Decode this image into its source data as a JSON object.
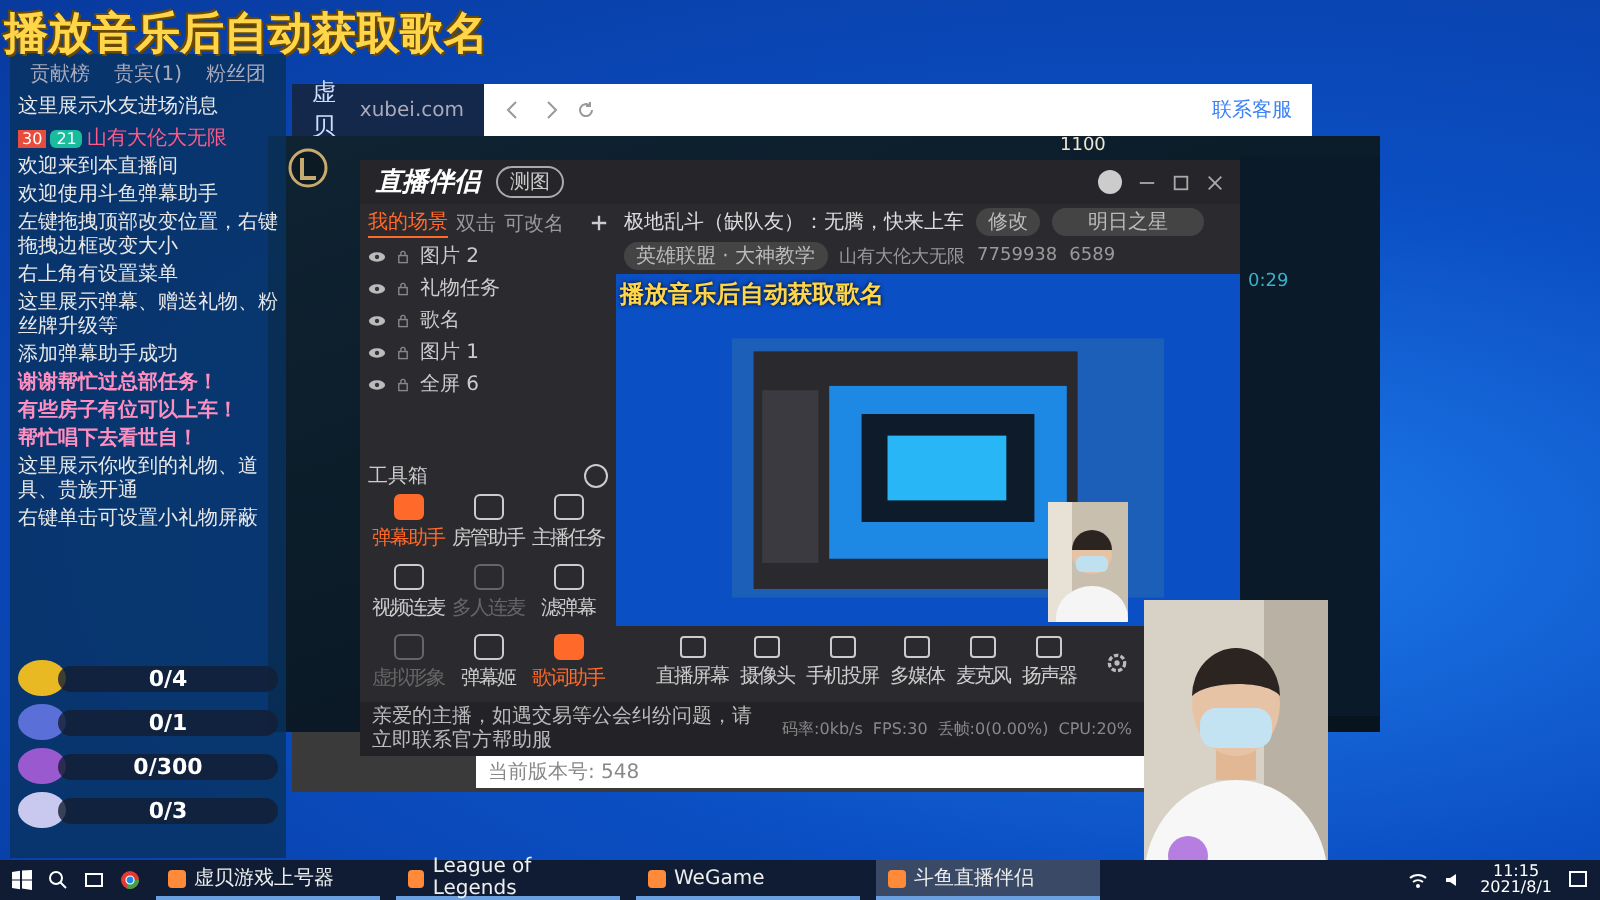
{
  "headline": "播放音乐后自动获取歌名",
  "overlay_panel": {
    "tabs": [
      {
        "label": "贡献榜",
        "selected": false
      },
      {
        "label": "贵宾(1)",
        "selected": false
      },
      {
        "label": "粉丝团",
        "selected": false
      }
    ],
    "messages": [
      {
        "kind": "plain",
        "text": "这里展示水友进场消息"
      },
      {
        "kind": "entry",
        "badge": "30",
        "level": "21",
        "user": "山有大伦大无限",
        "text": "欢迎来到本直播间"
      },
      {
        "kind": "plain",
        "text": "欢迎使用斗鱼弹幕助手"
      },
      {
        "kind": "plain",
        "text": "左键拖拽顶部改变位置，右键拖拽边框改变大小"
      },
      {
        "kind": "plain",
        "text": "右上角有设置菜单"
      },
      {
        "kind": "plain",
        "text": "这里展示弹幕、赠送礼物、粉丝牌升级等"
      },
      {
        "kind": "plain",
        "text": "添加弹幕助手成功"
      },
      {
        "kind": "pink",
        "text": "谢谢帮忙过总部任务！"
      },
      {
        "kind": "pink",
        "text": "有些房子有位可以上车！"
      },
      {
        "kind": "pink",
        "text": "帮忙唱下去看世自！"
      },
      {
        "kind": "plain",
        "text": "这里展示你收到的礼物、道具、贵族开通"
      },
      {
        "kind": "plain",
        "text": "右键单击可设置小礼物屏蔽"
      }
    ],
    "tasks": [
      {
        "count": "0/4",
        "color": "#e8b923",
        "level": 0
      },
      {
        "count": "0/1",
        "color": "#5a6fd8",
        "level": 0
      },
      {
        "count": "0/300",
        "color": "#9b59d0",
        "level": 0
      },
      {
        "count": "0/3",
        "color": "#c9c9f0",
        "level": 0
      }
    ]
  },
  "browser": {
    "logo": "虚贝",
    "domain": "xubei.com",
    "service": "联系客服",
    "version": "当前版本号: 548"
  },
  "game_client": {
    "currency": "1100",
    "timer": "0:29"
  },
  "app": {
    "title": "直播伴侣",
    "tag": "测图",
    "scene_tabs": [
      {
        "label": "我的场景",
        "selected": true
      },
      {
        "label": "双击",
        "selected": false
      },
      {
        "label": "可改名",
        "selected": false
      }
    ],
    "scenes": [
      "图片 2",
      "礼物任务",
      "歌名",
      "图片 1",
      "全屏 6"
    ],
    "toolbox_title": "工具箱",
    "tools": [
      {
        "label": "弹幕助手",
        "active": true,
        "disabled": false
      },
      {
        "label": "房管助手",
        "active": false,
        "disabled": false
      },
      {
        "label": "主播任务",
        "active": false,
        "disabled": false
      },
      {
        "label": "视频连麦",
        "active": false,
        "disabled": false
      },
      {
        "label": "多人连麦",
        "active": false,
        "disabled": true
      },
      {
        "label": "滤弹幕",
        "active": false,
        "disabled": false
      },
      {
        "label": "虚拟形象",
        "active": false,
        "disabled": true
      },
      {
        "label": "弹幕姬",
        "active": false,
        "disabled": false
      },
      {
        "label": "歌词助手",
        "active": true,
        "disabled": false
      }
    ],
    "room_title": "极地乱斗（缺队友）：无腾，快来上车",
    "edit_button": "修改",
    "rank": "明日之星",
    "category": "英雄联盟 · 大神教学",
    "streamer": "山有大伦大无限",
    "room_id": "7759938",
    "heat": "6589",
    "preview_caption": "播放音乐后自动获取歌名",
    "sources": [
      "直播屏幕",
      "摄像头",
      "手机投屏",
      "多媒体",
      "麦克风",
      "扬声器"
    ],
    "notice": "亲爱的主播，如遇交易等公会纠纷问题，请立即联系官方帮助服",
    "stats": [
      "码率:0kb/s",
      "FPS:30",
      "丢帧:0(0.00%)",
      "CPU:20%"
    ]
  },
  "taskbar": {
    "apps": [
      {
        "label": "虚贝游戏上号器",
        "selected": false
      },
      {
        "label": "League of Legends",
        "selected": false
      },
      {
        "label": "WeGame",
        "selected": false
      },
      {
        "label": "斗鱼直播伴侣",
        "selected": true
      }
    ],
    "time": "11:15",
    "date": "2021/8/1"
  }
}
